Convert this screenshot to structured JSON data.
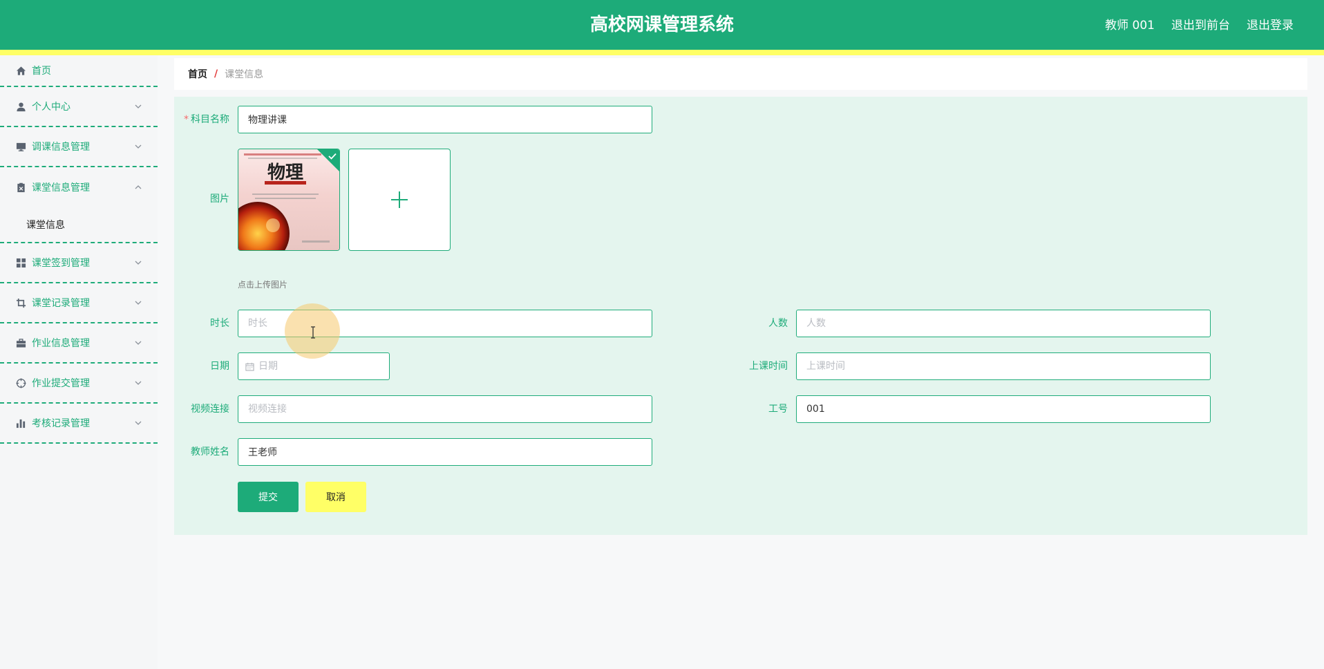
{
  "header": {
    "title": "高校网课管理系统",
    "user_label": "教师 001",
    "to_front_label": "退出到前台",
    "logout_label": "退出登录"
  },
  "sidebar": {
    "items": [
      {
        "label": "首页",
        "icon": "home-icon"
      },
      {
        "label": "个人中心",
        "icon": "user-icon"
      },
      {
        "label": "调课信息管理",
        "icon": "monitor-icon"
      },
      {
        "label": "课堂信息管理",
        "icon": "clipboard-icon",
        "expanded": true,
        "sub": [
          "课堂信息"
        ]
      },
      {
        "label": "课堂签到管理",
        "icon": "grid-icon"
      },
      {
        "label": "课堂记录管理",
        "icon": "crop-icon"
      },
      {
        "label": "作业信息管理",
        "icon": "briefcase-icon"
      },
      {
        "label": "作业提交管理",
        "icon": "target-icon"
      },
      {
        "label": "考核记录管理",
        "icon": "bar-chart-icon"
      }
    ]
  },
  "breadcrumb": {
    "home": "首页",
    "separator": "/",
    "current": "课堂信息"
  },
  "form": {
    "subject": {
      "label": "科目名称",
      "required": "*",
      "value": "物理讲课"
    },
    "image": {
      "label": "图片",
      "hint": "点击上传图片",
      "book_title": "物理"
    },
    "duration": {
      "label": "时长",
      "placeholder": "时长"
    },
    "headcount": {
      "label": "人数",
      "placeholder": "人数"
    },
    "date": {
      "label": "日期",
      "placeholder": "日期"
    },
    "class_time": {
      "label": "上课时间",
      "placeholder": "上课时间"
    },
    "video_link": {
      "label": "视频连接",
      "placeholder": "视频连接"
    },
    "staff_id": {
      "label": "工号",
      "value": "001"
    },
    "teacher_name": {
      "label": "教师姓名",
      "value": "王老师"
    },
    "submit_label": "提交",
    "cancel_label": "取消"
  },
  "colors": {
    "accent": "#1dab79",
    "highlight": "#ffff66",
    "panel": "#e4f5ee"
  }
}
